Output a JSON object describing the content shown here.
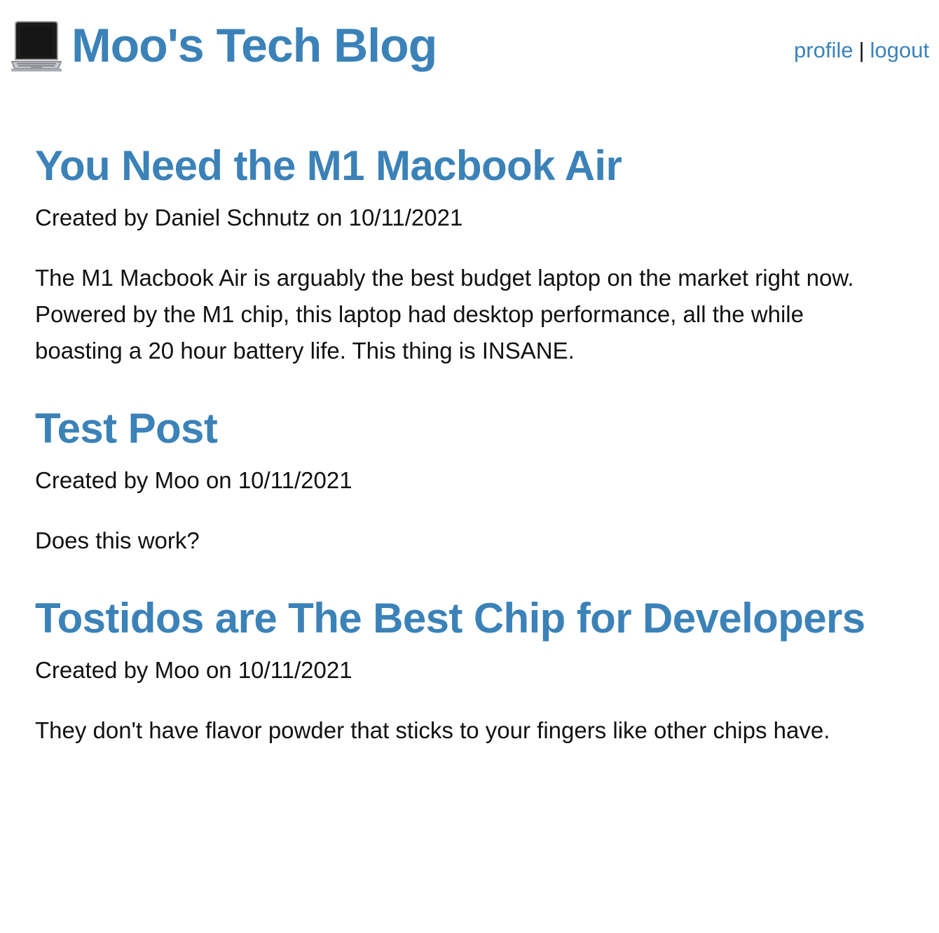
{
  "header": {
    "site_title": "Moo's Tech Blog",
    "logo_icon": "laptop-icon",
    "nav": {
      "profile_label": "profile",
      "separator": "|",
      "logout_label": "logout"
    }
  },
  "colors": {
    "accent": "#3b82b8",
    "text": "#111111",
    "background": "#ffffff"
  },
  "posts": [
    {
      "title": "You Need the M1 Macbook Air",
      "meta": "Created by Daniel Schnutz on 10/11/2021",
      "body": "The M1 Macbook Air is arguably the best budget laptop on the market right now. Powered by the M1 chip, this laptop had desktop performance, all the while boasting a 20 hour battery life. This thing is INSANE."
    },
    {
      "title": "Test Post",
      "meta": "Created by Moo on 10/11/2021",
      "body": "Does this work?"
    },
    {
      "title": "Tostidos are The Best Chip for Developers",
      "meta": "Created by Moo on 10/11/2021",
      "body": "They don't have flavor powder that sticks to your fingers like other chips have."
    }
  ]
}
